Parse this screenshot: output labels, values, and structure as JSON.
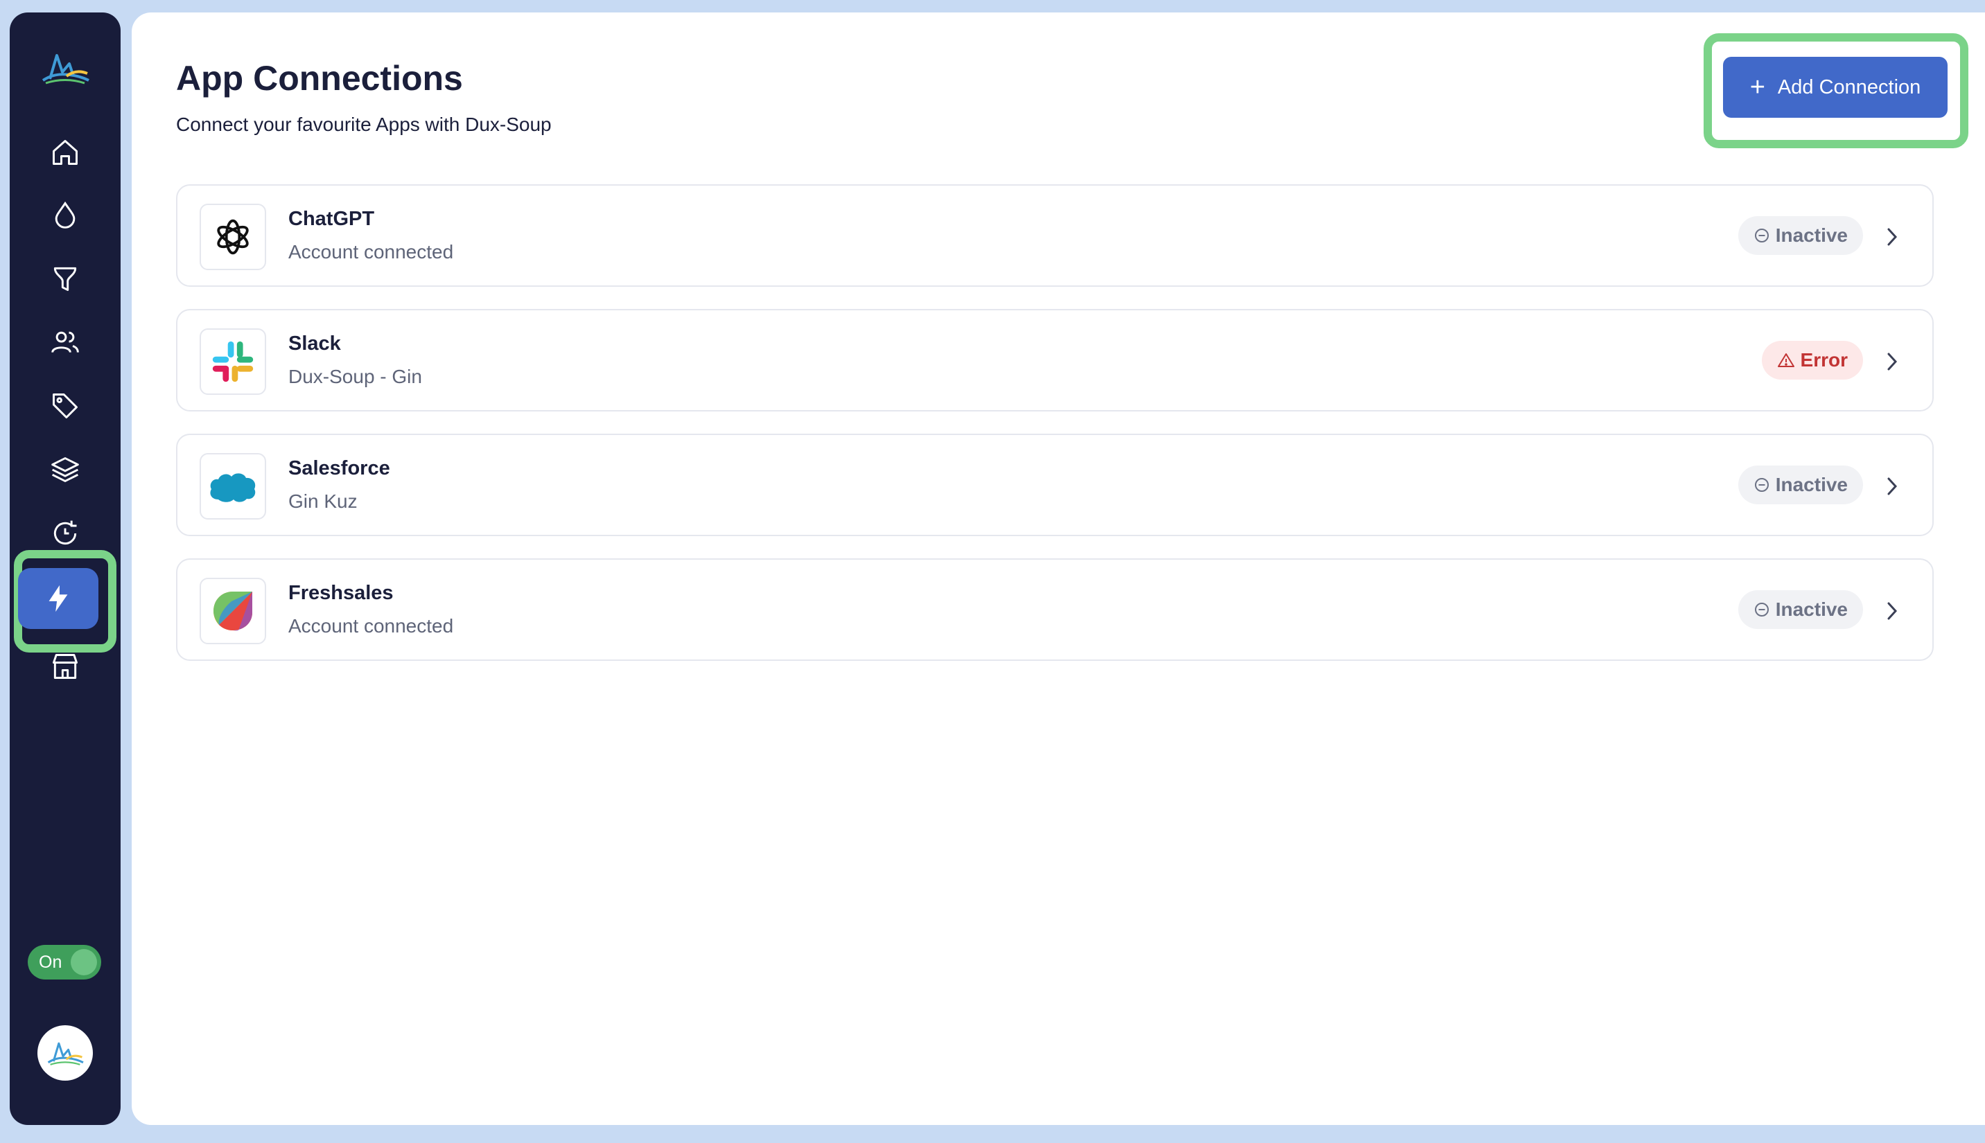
{
  "page": {
    "title": "App Connections",
    "subtitle": "Connect your favourite Apps with Dux-Soup"
  },
  "header": {
    "add_button_label": "Add Connection"
  },
  "sidebar": {
    "items": [
      {
        "icon": "home-icon"
      },
      {
        "icon": "drop-icon"
      },
      {
        "icon": "funnel-icon"
      },
      {
        "icon": "users-icon"
      },
      {
        "icon": "tag-icon"
      },
      {
        "icon": "layers-icon"
      },
      {
        "icon": "history-icon"
      },
      {
        "icon": "lightning-icon",
        "active": true
      },
      {
        "icon": "store-icon"
      }
    ],
    "toggle_label": "On"
  },
  "connections": [
    {
      "name": "ChatGPT",
      "detail": "Account connected",
      "status": "Inactive",
      "icon": "chatgpt-logo-icon"
    },
    {
      "name": "Slack",
      "detail": "Dux-Soup - Gin",
      "status": "Error",
      "icon": "slack-logo-icon"
    },
    {
      "name": "Salesforce",
      "detail": "Gin Kuz",
      "status": "Inactive",
      "icon": "salesforce-logo-icon"
    },
    {
      "name": "Freshsales",
      "detail": "Account connected",
      "status": "Inactive",
      "icon": "freshsales-logo-icon"
    }
  ],
  "colors": {
    "accent": "#4169c9",
    "sidebar_bg": "#181c3a",
    "highlight": "#7bd389",
    "error": "#c23434",
    "toggle_on": "#3f9f5b"
  }
}
